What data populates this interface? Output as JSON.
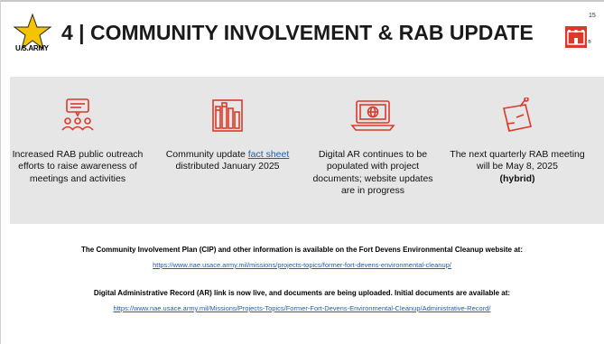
{
  "page_number": "15",
  "header": {
    "title": "4 | COMMUNITY INVOLVEMENT & RAB UPDATE",
    "army_label": "U.S.ARMY",
    "registered_mark": "®"
  },
  "columns": [
    {
      "icon": "meeting-speech-icon",
      "text": "Increased RAB public outreach efforts to raise awareness of meetings and activities"
    },
    {
      "icon": "binders-icon",
      "text_before": "Community update ",
      "link_text": "fact sheet",
      "text_after": " distributed January 2025"
    },
    {
      "icon": "laptop-globe-icon",
      "text": "Digital AR continues to be populated with project documents; website updates are in progress"
    },
    {
      "icon": "calendar-note-icon",
      "text": "The next quarterly RAB meeting will be May 8, 2025",
      "bold_text": "(hybrid)"
    }
  ],
  "info": {
    "cip_text": "The Community Involvement Plan (CIP) and other information is available on the Fort Devens Environmental Cleanup website at:",
    "cip_link": "https://www.nae.usace.army.mil/missions/projects-topics/former-fort-devens-environmental-cleanup/",
    "ar_text": "Digital Administrative Record (AR) link is now live, and documents are being uploaded. Initial documents are available at:",
    "ar_link": "https://www.nae.usace.army.mil/Missions/Projects-Topics/Former-Fort-Devens-Environmental-Cleanup/Administrative-Record/"
  },
  "colors": {
    "army_gold": "#f5c400",
    "accent_red": "#d93a2b",
    "band_gray": "#e6e6e6",
    "link_blue": "#1f5fa8"
  }
}
